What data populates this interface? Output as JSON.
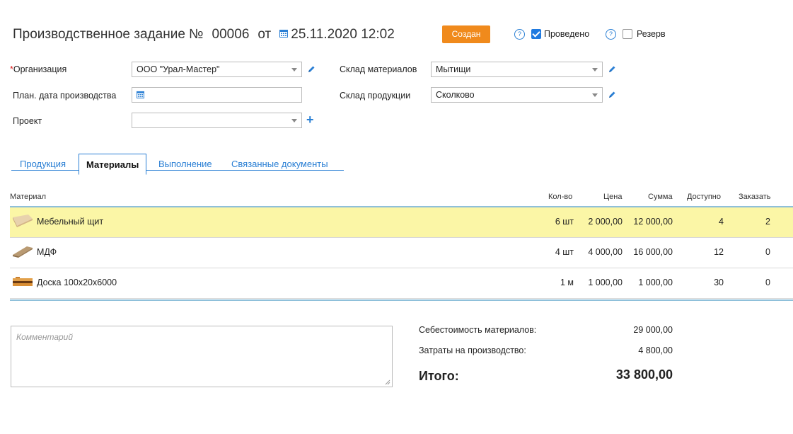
{
  "header": {
    "title": "Производственное задание №",
    "number": "00006",
    "from_label": "от",
    "date": "25.11.2020 12:02",
    "status": "Создан",
    "help1": "?",
    "posted_label": "Проведено",
    "posted_checked": true,
    "help2": "?",
    "reserve_label": "Резерв",
    "reserve_checked": false,
    "status_color": "#f08a1c"
  },
  "form": {
    "org_label": "Организация",
    "org_required": "*",
    "org_value": "ООО \"Урал-Мастер\"",
    "plan_date_label": "План. дата производства",
    "plan_date_value": "",
    "project_label": "Проект",
    "project_value": "",
    "materials_wh_label": "Склад материалов",
    "materials_wh_value": "Мытищи",
    "products_wh_label": "Склад продукции",
    "products_wh_value": "Сколково"
  },
  "tabs": [
    {
      "label": "Продукция",
      "active": false
    },
    {
      "label": "Материалы",
      "active": true
    },
    {
      "label": "Выполнение",
      "active": false
    },
    {
      "label": "Связанные документы",
      "active": false
    }
  ],
  "table": {
    "columns": [
      "Материал",
      "Кол-во",
      "Цена",
      "Сумма",
      "Доступно",
      "Заказать"
    ],
    "rows": [
      {
        "name": "Мебельный щит",
        "qty": "6 шт",
        "price": "2 000,00",
        "sum": "12 000,00",
        "available": "4",
        "order": "2",
        "selected": true
      },
      {
        "name": "МДФ",
        "qty": "4 шт",
        "price": "4 000,00",
        "sum": "16 000,00",
        "available": "12",
        "order": "0",
        "selected": false
      },
      {
        "name": "Доска 100x20x6000",
        "qty": "1 м",
        "price": "1 000,00",
        "sum": "1 000,00",
        "available": "30",
        "order": "0",
        "selected": false
      }
    ]
  },
  "footer": {
    "comment_placeholder": "Комментарий",
    "materials_cost_label": "Себестоимость материалов:",
    "materials_cost_value": "29 000,00",
    "production_cost_label": "Затраты на производство:",
    "production_cost_value": "4 800,00",
    "total_label": "Итого:",
    "total_value": "33 800,00"
  },
  "colors": {
    "accent": "#2a7fd4",
    "selected_row": "#fbf6a6",
    "status": "#f08a1c"
  }
}
